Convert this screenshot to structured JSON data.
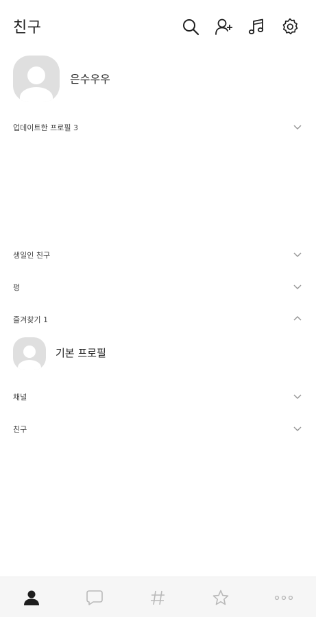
{
  "header": {
    "title": "친구",
    "icons": [
      "search-icon",
      "add-friend-icon",
      "music-icon",
      "settings-icon"
    ]
  },
  "my_profile": {
    "name": "은수우우"
  },
  "sections": {
    "updated_profiles": "업데이트한 프로필 3",
    "birthday_friends": "생일인 친구",
    "group": "펑",
    "favorites": "즐겨찾기 1",
    "channel": "채널",
    "friends": "친구"
  },
  "favorites": [
    {
      "name": "기본 프로필"
    }
  ],
  "tabbar": {
    "tabs": [
      "friends-tab",
      "chats-tab",
      "hashtag-tab",
      "shopping-tab",
      "more-tab"
    ],
    "active": "friends-tab"
  },
  "colors": {
    "text": "#1e1e1e",
    "muted": "#444444",
    "avatar_bg": "#dfdfdf",
    "tabbar_bg": "#f6f6f6",
    "icon_inactive": "#b9b9b9"
  }
}
